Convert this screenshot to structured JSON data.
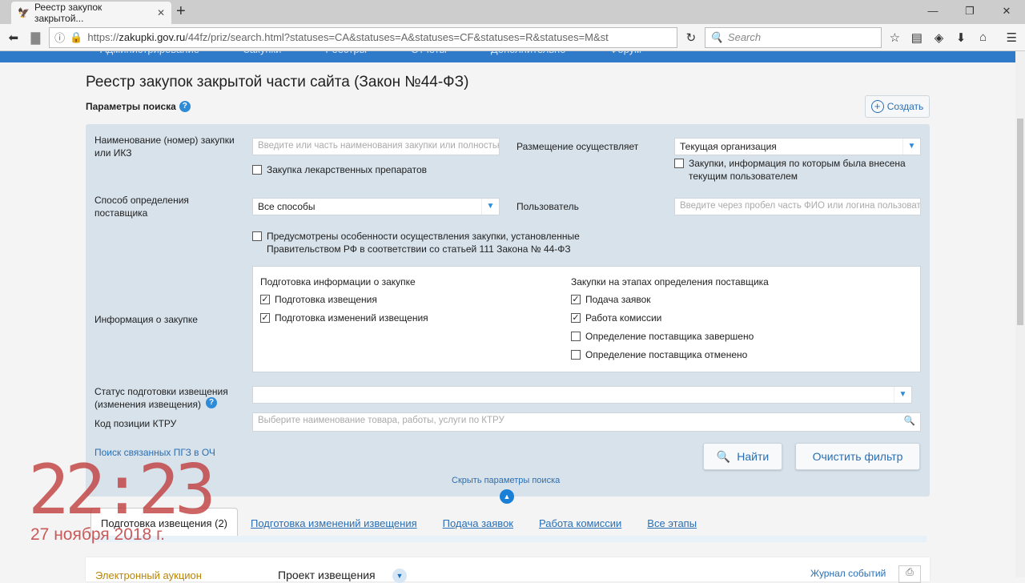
{
  "browser": {
    "tab_title": "Реестр закупок закрытой...",
    "url_prefix": "https://",
    "url_domain": "zakupki.gov.ru",
    "url_rest": "/44fz/priz/search.html?statuses=CA&statuses=A&statuses=CF&statuses=R&statuses=M&st",
    "search_placeholder": "Search"
  },
  "menu": [
    "Администрирование",
    "Закупки",
    "Реестры",
    "Отчеты",
    "Дополнительно",
    "Форум"
  ],
  "page": {
    "title": "Реестр закупок закрытой части сайта (Закон №44-ФЗ)",
    "params_title": "Параметры поиска",
    "create": "Создать"
  },
  "form": {
    "name_label": "Наименование (номер) закупки или ИКЗ",
    "name_placeholder": "Введите или часть наименования закупки или полностью",
    "drugs": "Закупка лекарственных препаратов",
    "placement_label": "Размещение осуществляет",
    "placement_value": "Текущая организация",
    "by_user": "Закупки, информация по которым была внесена текущим пользователем",
    "method_label": "Способ определения поставщика",
    "method_value": "Все способы",
    "user_label": "Пользователь",
    "user_placeholder": "Введите через пробел часть ФИО или логина пользователя",
    "art111": "Предусмотрены особенности осуществления закупки, установленные Правительством РФ в соответствии со статьей 111 Закона № 44-ФЗ",
    "info_label": "Информация о закупке",
    "prep_title": "Подготовка информации о закупке",
    "prep_items": [
      {
        "label": "Подготовка извещения",
        "checked": true
      },
      {
        "label": "Подготовка изменений извещения",
        "checked": true
      }
    ],
    "stage_title": "Закупки на этапах определения поставщика",
    "stage_items": [
      {
        "label": "Подача заявок",
        "checked": true
      },
      {
        "label": "Работа комиссии",
        "checked": true
      },
      {
        "label": "Определение поставщика завершено",
        "checked": false
      },
      {
        "label": "Определение поставщика отменено",
        "checked": false
      }
    ],
    "status_label": "Статус подготовки извещения (изменения извещения)",
    "ktru_label": "Код позиции КТРУ",
    "ktru_placeholder": "Выберите наименование товара, работы, услуги по КТРУ",
    "linked": "Поиск связанных ПГЗ в ОЧ",
    "find": "Найти",
    "clear": "Очистить фильтр",
    "hide": "Скрыть параметры поиска"
  },
  "tabs": [
    "Подготовка извещения (2)",
    "Подготовка изменений извещения",
    "Подача заявок",
    "Работа комиссии",
    "Все этапы"
  ],
  "result": {
    "type": "Электронный аукцион",
    "status": "Проект извещения",
    "journal": "Журнал событий"
  },
  "overlay": {
    "time": "22:23",
    "date": "27 ноября 2018 г."
  }
}
